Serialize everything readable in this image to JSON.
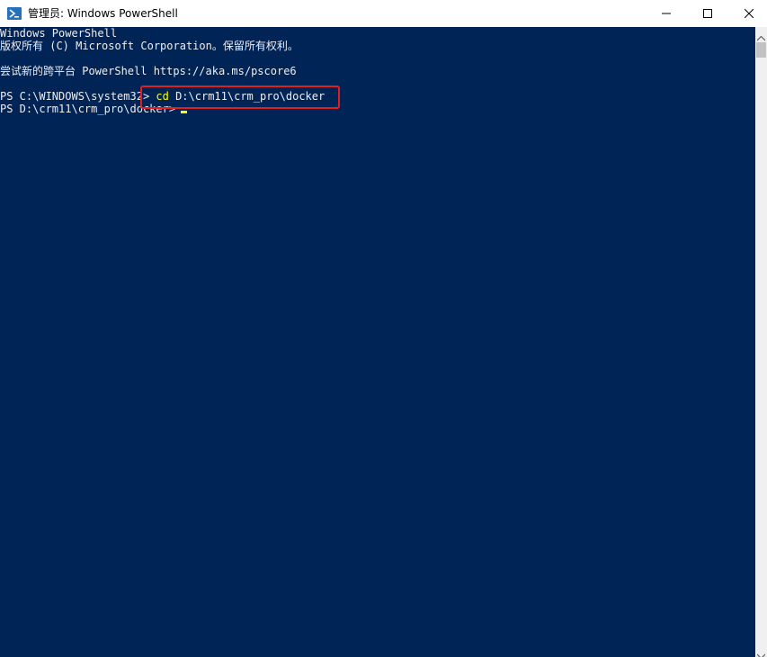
{
  "window": {
    "title": "管理员: Windows PowerShell",
    "icon": "powershell-icon",
    "controls": {
      "minimize_icon": "minimize-icon",
      "maximize_icon": "maximize-icon",
      "close_icon": "close-icon"
    }
  },
  "console": {
    "background": "#012456",
    "text_color": "#eeedf0",
    "command_color": "#ffff00",
    "lines": {
      "header1": "Windows PowerShell",
      "header2": "版权所有 (C) Microsoft Corporation。保留所有权利。",
      "header3": "尝试新的跨平台 PowerShell https://aka.ms/pscore6",
      "prompt1": "PS C:\\WINDOWS\\system32> ",
      "command_name": "cd",
      "command_args": " D:\\crm11\\crm_pro\\docker",
      "prompt2": "PS D:\\crm11\\crm_pro\\docker>"
    },
    "highlight_color": "#e02020"
  },
  "scrollbar": {
    "up_icon": "scroll-up-arrow-icon",
    "down_icon": "scroll-down-arrow-icon"
  }
}
